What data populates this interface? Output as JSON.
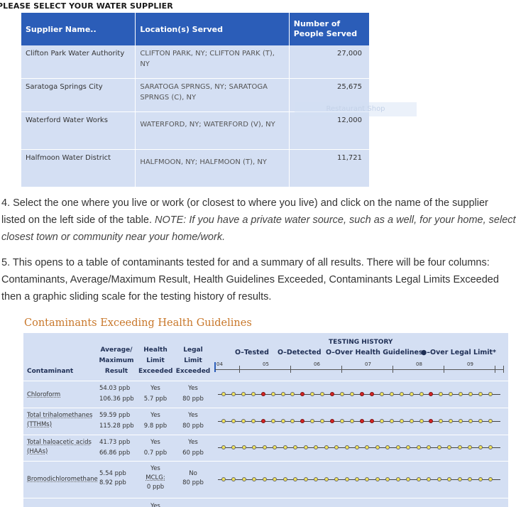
{
  "supplier_heading": "PLEASE SELECT YOUR WATER SUPPLIER",
  "supplier_table": {
    "headers": [
      "Supplier Name..",
      "Location(s) Served",
      "Number of People Served"
    ],
    "rows": [
      {
        "name": "Clifton Park Water Authority",
        "location": "CLIFTON PARK, NY; CLIFTON PARK (T), NY",
        "people": "27,000"
      },
      {
        "name": "Saratoga Springs City",
        "location": "SARATOGA SPRNGS, NY; SARATOGA SPRNGS (C), NY",
        "people": "25,675"
      },
      {
        "name": "Waterford Water Works",
        "location": "WATERFORD, NY; WATERFORD (V), NY",
        "people": "12,000"
      },
      {
        "name": "Halfmoon Water District",
        "location": "HALFMOON, NY; HALFMOON (T), NY",
        "people": "11,721"
      }
    ],
    "ghost_tooltip": "Restaurant Shop"
  },
  "para4_l1": "4. Select the one where you live or work (or closest to where you live) and click on the name of the supplier",
  "para4_l2a": "listed on the left side of the table. ",
  "para4_l2b": "NOTE: If you have a private water source, such as a well, for your home, select",
  "para4_l3": "closest town or community near your home/work.",
  "para5_l1": "5. This opens to a table of contaminants tested for and a summary of all results. There will be four columns:",
  "para5_l2": "Contaminants, Average/Maximum Result, Health Guidelines Exceeded, Contaminants Legal Limits Exceeded",
  "para5_l3": "then a graphic sliding scale for the testing history of results.",
  "contam_title": "Contaminants Exceeding Health Guidelines",
  "contam_table": {
    "col_contaminant": "Contaminant",
    "col_avg_1": "Average/",
    "col_avg_2": "Maximum",
    "col_avg_3": "Result",
    "col_health_1": "Health",
    "col_health_2": "Limit",
    "col_health_3": "Exceeded",
    "col_legal_1": "Legal",
    "col_legal_2": "Limit",
    "col_legal_3": "Exceeded",
    "history_title": "TESTING HISTORY",
    "legend": {
      "tested": "O–Tested",
      "detected": "O–Detected",
      "over_health": "O–Over Health Guidelines",
      "over_legal": "●–Over Legal Limit*"
    },
    "years": [
      "04",
      "05",
      "06",
      "07",
      "08",
      "09"
    ],
    "rows": [
      {
        "name": "Chloroform",
        "avg": "54.03 ppb",
        "max": "106.36 ppb",
        "health": "Yes",
        "health_limit": "5.7 ppb",
        "legal": "Yes",
        "legal_limit": "80 ppb",
        "history": "yyyyryyyryyryyrryyyyyryyyyyy"
      },
      {
        "name_1": "Total trihalomethanes",
        "name_2": "(TTHMs)",
        "avg": "59.59 ppb",
        "max": "115.28 ppb",
        "health": "Yes",
        "health_limit": "9.8 ppb",
        "legal": "Yes",
        "legal_limit": "80 ppb",
        "history": "yyyyryyyryyryyrryyyyyryyyyyy"
      },
      {
        "name_1": "Total haloacetic acids",
        "name_2": "(HAAs)",
        "avg": "41.73 ppb",
        "max": "66.86 ppb",
        "health": "Yes",
        "health_limit": "0.7 ppb",
        "legal": "Yes",
        "legal_limit": "60 ppb",
        "history": "yyyyyyyyyyyyyyyyyyyyyyyyyyy"
      },
      {
        "name": "Bromodichloromethane",
        "avg": "5.54 ppb",
        "max": "8.92 ppb",
        "health": "Yes",
        "health_limit_1": "MCLG:",
        "health_limit_2": "0 ppb",
        "legal": "No",
        "legal_limit": "80 ppb",
        "history": "yyyyyyyyyyyyyyyyyyyyyyyyyyy"
      }
    ],
    "cut_next": "Yes"
  }
}
